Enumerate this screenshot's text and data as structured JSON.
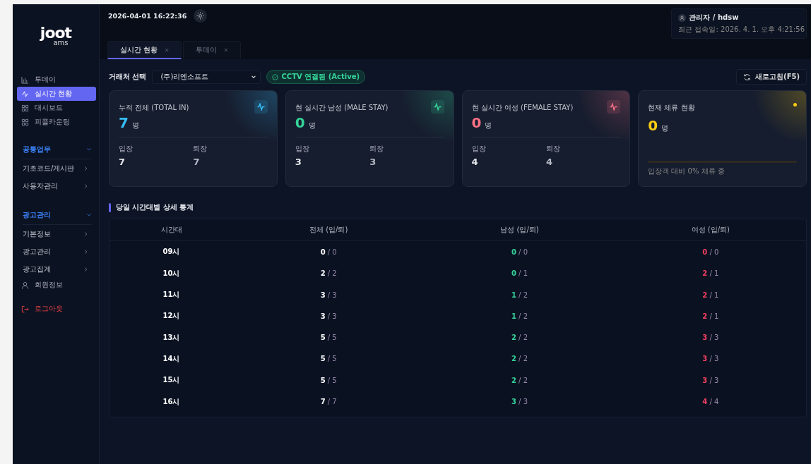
{
  "sidebar": {
    "logo": {
      "main": "joot",
      "sub": "ams"
    },
    "menu": [
      {
        "kind": "link",
        "label": "투데이",
        "selected": false
      },
      {
        "kind": "link",
        "label": "실시간 현황",
        "selected": true
      },
      {
        "kind": "link",
        "label": "대시보드",
        "selected": false
      },
      {
        "kind": "link",
        "label": "피플카운팅",
        "selected": false
      },
      {
        "kind": "section",
        "label": "공통업무",
        "expanded": true
      },
      {
        "kind": "folder",
        "label": "기초코드/게시판"
      },
      {
        "kind": "folder",
        "label": "사용자관리"
      },
      {
        "kind": "section",
        "label": "광고관리",
        "expanded": true
      },
      {
        "kind": "folder",
        "label": "기본정보"
      },
      {
        "kind": "folder",
        "label": "광고관리"
      },
      {
        "kind": "folder",
        "label": "광고집계"
      },
      {
        "kind": "user",
        "label": "회원정보"
      },
      {
        "kind": "logout",
        "label": "로그아웃"
      }
    ]
  },
  "header": {
    "datetime": "2026-04-01 16:22:36",
    "user": "관리자 / hdsw",
    "last_login": "최근 접속일: 2026. 4. 1. 오후 4:21:56"
  },
  "tabs": [
    {
      "label": "실시간 현황",
      "selected": true
    },
    {
      "label": "투데이",
      "selected": false
    }
  ],
  "toolbar": {
    "label": "거래처 선택",
    "client": "(주)리엔소프트",
    "cctv_status": "CCTV 연결됨 (Active)",
    "refresh": "새로고침(F5)"
  },
  "cards": [
    {
      "kind": "stat",
      "title": "누적 전체 (TOTAL IN)",
      "color": "#38bdf8",
      "value": "7",
      "unit": "명",
      "in_label": "입장",
      "in_value": "7",
      "out_label": "퇴장",
      "out_value": "7"
    },
    {
      "kind": "stat",
      "title": "현 실시간 남성 (MALE STAY)",
      "color": "#34d399",
      "value": "0",
      "unit": "명",
      "in_label": "입장",
      "in_value": "3",
      "out_label": "퇴장",
      "out_value": "3"
    },
    {
      "kind": "stat",
      "title": "현 실시간 여성 (FEMALE STAY)",
      "color": "#fb7185",
      "value": "0",
      "unit": "명",
      "in_label": "입장",
      "in_value": "4",
      "out_label": "퇴장",
      "out_value": "4"
    },
    {
      "kind": "stay",
      "title": "현재 체류 현황",
      "color": "#facc15",
      "value": "0",
      "unit": "명",
      "level": 0,
      "caption": "입장객 대비 0% 체류 중"
    }
  ],
  "table": {
    "title": "당일 시간대별 상세 통계",
    "columns": [
      "시간대",
      "전체 (입/퇴)",
      "남성 (입/퇴)",
      "여성 (입/퇴)"
    ],
    "rows": [
      [
        "09시",
        "**0** / 0",
        "**0** / 0",
        "**0** / 0"
      ],
      [
        "10시",
        "**2** / 2",
        "**0** / 1",
        "**2** / 1"
      ],
      [
        "11시",
        "**3** / 3",
        "**1** / 2",
        "**2** / 1"
      ],
      [
        "12시",
        "**3** / 3",
        "**1** / 2",
        "**2** / 1"
      ],
      [
        "13시",
        "**5** / 5",
        "**2** / 2",
        "**3** / 3"
      ],
      [
        "14시",
        "**5** / 5",
        "**2** / 2",
        "**3** / 3"
      ],
      [
        "15시",
        "**5** / 5",
        "**2** / 2",
        "**3** / 3"
      ],
      [
        "16시",
        "**7** / 7",
        "**3** / 3",
        "**4** / 4"
      ]
    ]
  }
}
